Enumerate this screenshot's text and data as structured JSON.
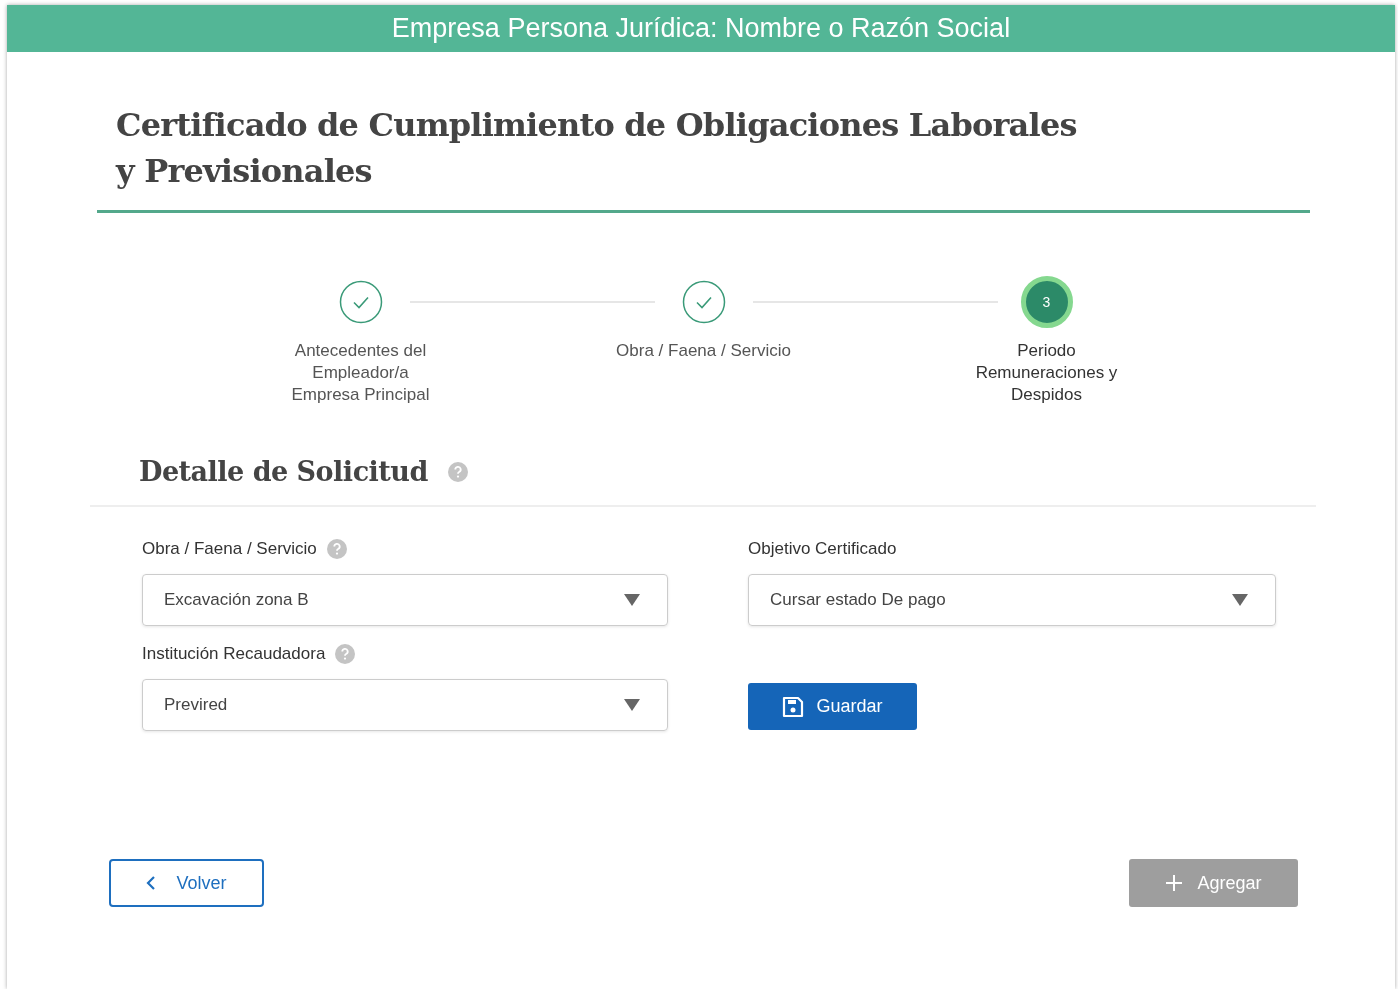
{
  "header": {
    "title": "Empresa Persona Jurídica: Nombre o Razón Social"
  },
  "page_title": "Certificado de Cumplimiento de Obligaciones Laborales y Previsionales",
  "steps": [
    {
      "label": "Antecedentes del Empleador/a Empresa Principal",
      "done": true,
      "selected": false
    },
    {
      "label": "Obra / Faena / Servicio",
      "done": true,
      "selected": false
    },
    {
      "label": "Periodo Remuneraciones y Despidos",
      "done": false,
      "selected": true,
      "number": "3"
    }
  ],
  "section": {
    "title": "Detalle de Solicitud",
    "help": true
  },
  "fields": [
    {
      "label": "Obra / Faena / Servicio",
      "help": true,
      "value": "Excavación zona B"
    },
    {
      "label": "Objetivo Certificado",
      "help": false,
      "value": "Cursar estado De pago"
    },
    {
      "label": "Institución Recaudadora",
      "help": true,
      "value": "Previred"
    }
  ],
  "save_button": {
    "label": "Guardar",
    "disabled": false
  },
  "back_button": {
    "label": "Volver",
    "disabled": false
  },
  "add_button": {
    "label": "Agregar",
    "disabled": true
  }
}
